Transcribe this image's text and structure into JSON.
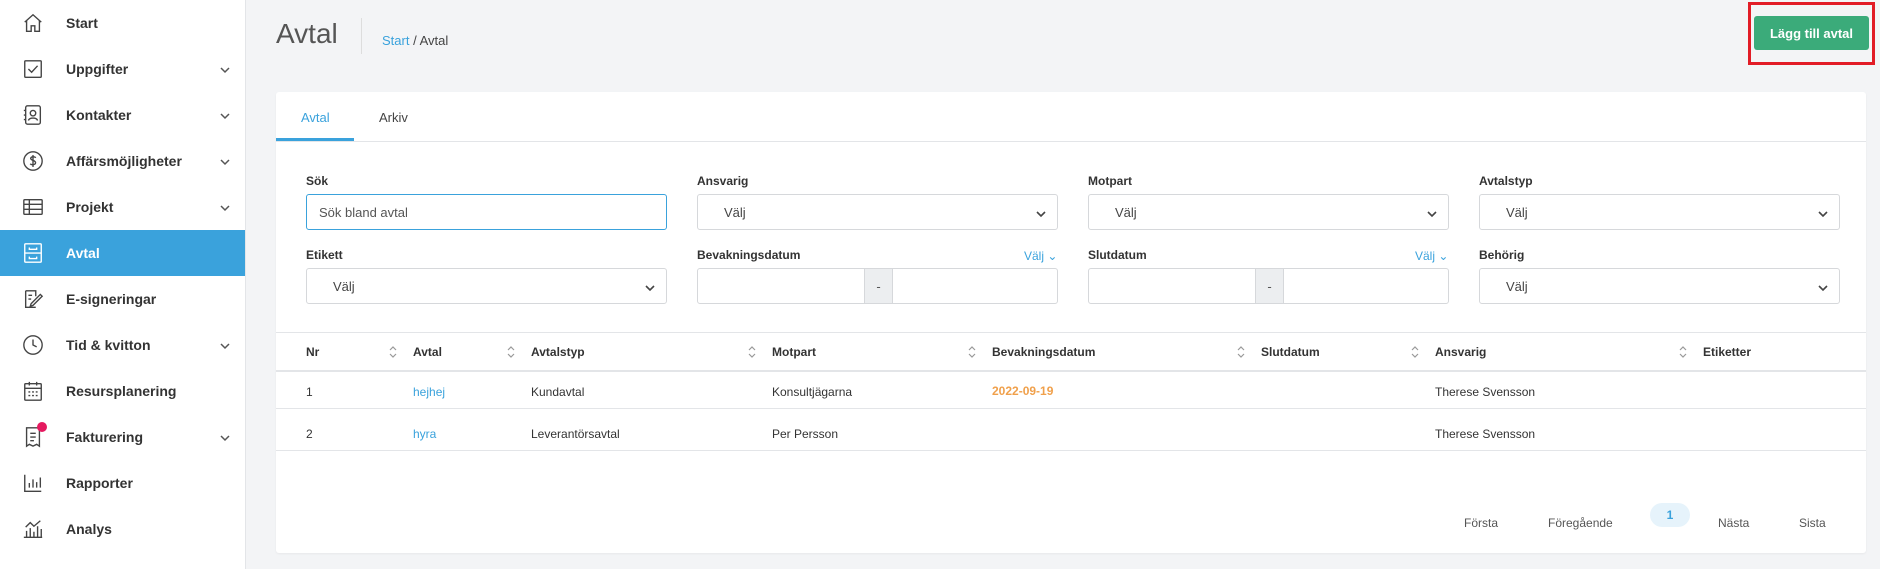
{
  "sidebar": {
    "items": [
      {
        "label": "Start",
        "icon": "home-icon"
      },
      {
        "label": "Uppgifter",
        "icon": "checkbox-icon"
      },
      {
        "label": "Kontakter",
        "icon": "contacts-icon"
      },
      {
        "label": "Affärsmöjligheter",
        "icon": "dollar-icon"
      },
      {
        "label": "Projekt",
        "icon": "table-icon"
      },
      {
        "label": "Avtal",
        "icon": "cabinet-icon"
      },
      {
        "label": "E-signeringar",
        "icon": "signature-icon"
      },
      {
        "label": "Tid & kvitton",
        "icon": "clock-icon"
      },
      {
        "label": "Resursplanering",
        "icon": "calendar-icon"
      },
      {
        "label": "Fakturering",
        "icon": "invoice-icon"
      },
      {
        "label": "Rapporter",
        "icon": "bar-chart-icon"
      },
      {
        "label": "Analys",
        "icon": "line-chart-icon"
      }
    ],
    "active_item": "Avtal",
    "accent_color": "#3aa2dc"
  },
  "header": {
    "title": "Avtal",
    "breadcrumb": {
      "link": "Start",
      "separator": " / ",
      "current": "Avtal"
    },
    "add_button": "Lägg till avtal",
    "add_button_color": "#3bab7a",
    "highlight_color": "#e21c26"
  },
  "tabs": {
    "items": [
      "Avtal",
      "Arkiv"
    ],
    "active": "Avtal"
  },
  "filters": {
    "sok": {
      "label": "Sök",
      "placeholder": "Sök bland avtal",
      "value": ""
    },
    "ansvarig": {
      "label": "Ansvarig",
      "value": "Välj"
    },
    "motpart": {
      "label": "Motpart",
      "value": "Välj"
    },
    "avtalstyp": {
      "label": "Avtalstyp",
      "value": "Välj"
    },
    "etikett": {
      "label": "Etikett",
      "value": "Välj"
    },
    "bevakningsdatum": {
      "label": "Bevakningsdatum",
      "link": "Välj",
      "separator": "-"
    },
    "slutdatum": {
      "label": "Slutdatum",
      "link": "Välj",
      "separator": "-"
    },
    "behorig": {
      "label": "Behörig",
      "value": "Välj"
    }
  },
  "table": {
    "columns": [
      "Nr",
      "Avtal",
      "Avtalstyp",
      "Motpart",
      "Bevakningsdatum",
      "Slutdatum",
      "Ansvarig",
      "Etiketter"
    ],
    "rows": [
      {
        "nr": "1",
        "avtal": "hejhej",
        "avtalstyp": "Kundavtal",
        "motpart": "Konsultjägarna",
        "bevakningsdatum": "2022-09-19",
        "slutdatum": "",
        "ansvarig": "Therese Svensson",
        "etiketter": ""
      },
      {
        "nr": "2",
        "avtal": "hyra",
        "avtalstyp": "Leverantörsavtal",
        "motpart": "Per Persson",
        "bevakningsdatum": "",
        "slutdatum": "",
        "ansvarig": "Therese Svensson",
        "etiketter": ""
      }
    ]
  },
  "pagination": {
    "first": "Första",
    "prev": "Föregående",
    "current": "1",
    "next": "Nästa",
    "last": "Sista"
  }
}
